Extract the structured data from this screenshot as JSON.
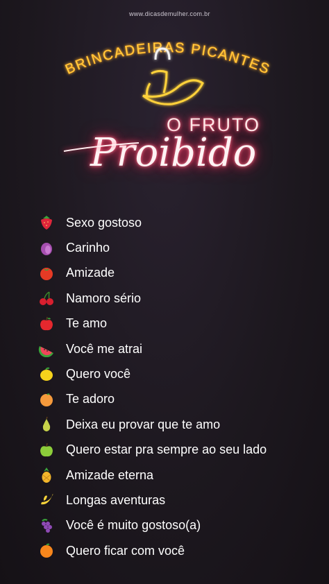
{
  "source": "www.dicasdemulher.com.br",
  "header": {
    "arc_title": "BRINCADEIRAS PICANTES",
    "subtitle": "O FRUTO",
    "script_title": "Proibido"
  },
  "items": [
    {
      "icon": "strawberry-icon",
      "label": "Sexo gostoso",
      "color": "#e0263b"
    },
    {
      "icon": "sweet-potato-icon",
      "label": "Carinho",
      "color": "#a64fb0"
    },
    {
      "icon": "tomato-icon",
      "label": "Amizade",
      "color": "#e63a25"
    },
    {
      "icon": "cherries-icon",
      "label": "Namoro sério",
      "color": "#d81f2f"
    },
    {
      "icon": "red-apple-icon",
      "label": "Te amo",
      "color": "#e5282e"
    },
    {
      "icon": "watermelon-icon",
      "label": "Você me atrai",
      "color": "#f0465a"
    },
    {
      "icon": "lemon-icon",
      "label": "Quero você",
      "color": "#f5d21c"
    },
    {
      "icon": "peach-icon",
      "label": "Te adoro",
      "color": "#f59a3c"
    },
    {
      "icon": "pear-icon",
      "label": "Deixa eu provar que te amo",
      "color": "#c8d44a"
    },
    {
      "icon": "green-apple-icon",
      "label": "Quero estar pra sempre ao seu lado",
      "color": "#8ccd3a"
    },
    {
      "icon": "pineapple-icon",
      "label": "Amizade eterna",
      "color": "#f3b72b"
    },
    {
      "icon": "banana-icon",
      "label": "Longas aventuras",
      "color": "#f6d23a"
    },
    {
      "icon": "grapes-icon",
      "label": "Você é muito gostoso(a)",
      "color": "#8e4ab5"
    },
    {
      "icon": "orange-icon",
      "label": "Quero ficar com você",
      "color": "#f7861c"
    }
  ]
}
